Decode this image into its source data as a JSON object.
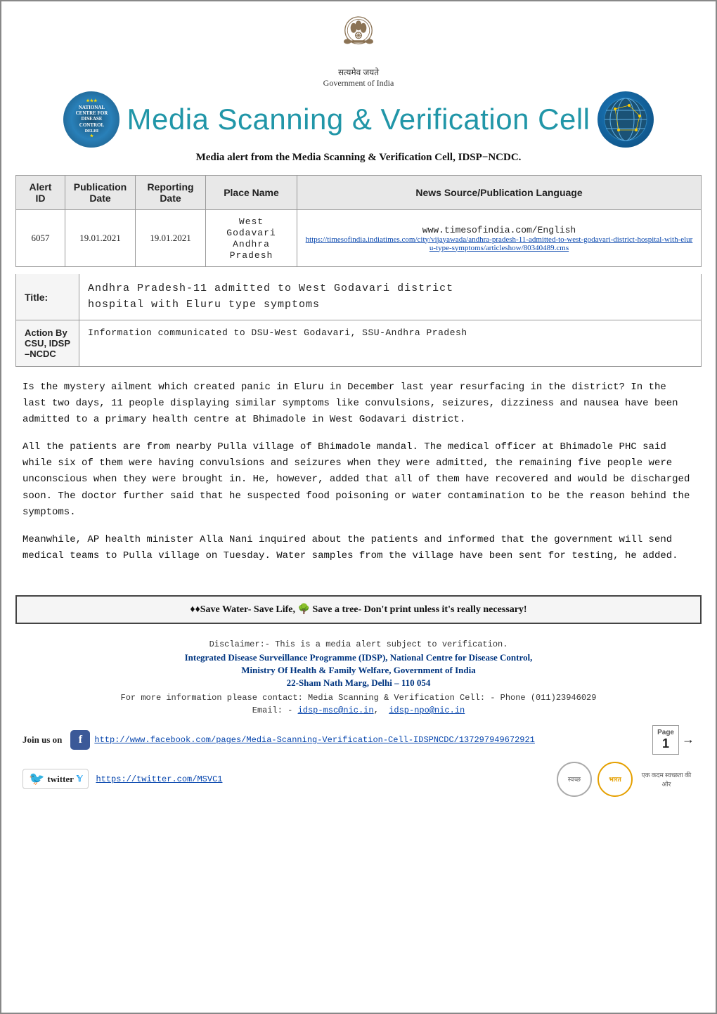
{
  "header": {
    "emblem_alt": "Government of India Emblem",
    "govt_label": "Government of India",
    "satyameva": "सत्यमेव जयते",
    "main_title": "Media Scanning & Verification Cell",
    "subtitle": "Media alert from the Media Scanning & Verification Cell, IDSP−NCDC.",
    "ncdc_label": "NATIONAL CENTRE FOR DISEASE CONTROL DELHI",
    "globe_alt": "Globe icon"
  },
  "table": {
    "headers": [
      "Alert ID",
      "Publication Date",
      "Reporting Date",
      "Place Name",
      "News Source/Publication Language"
    ],
    "row": {
      "alert_id": "6057",
      "pub_date": "19.01.2021",
      "rep_date": "19.01.2021",
      "place": "West Godavari\nAndhra\nPradesh",
      "news_source": "www.timesofindia.com/English",
      "news_link": "https://timesofindia.indiatimes.com/city/vijayawada/andhra-pradesh-11-admitted-to-west-godavari-district-hospital-with-eluru-type-symptoms/articleshow/80340489.cms",
      "news_link_short": "ndhra-pradesh-L-admitted-Lo-WeSt-!odavari-district-"
    }
  },
  "title_section": {
    "label": "Title:",
    "content": "Andhra Pradesh-11 admitted to West Godavari district\nhospital with Eluru type symptoms"
  },
  "action_section": {
    "label": "Action By\nCSU, IDSP\n–NCDC",
    "content": "Information communicated to DSU-West Godavari, SSU-Andhra Pradesh"
  },
  "body": {
    "paragraph1": "Is the mystery ailment which created panic in Eluru in December last year resurfacing in the district? In the last two days, 11 people displaying similar symptoms like convulsions, seizures, dizziness and nausea have been admitted to a primary health centre at Bhimadole in West Godavari district.",
    "paragraph2": "All the patients are from nearby Pulla village of Bhimadole mandal. The medical officer at Bhimadole PHC said while six of them were having convulsions and seizures when they were admitted, the remaining five people were unconscious when they were brought in. He, however, added that all of them have recovered and would be discharged soon. The doctor further said that he suspected food poisoning or water contamination to be the reason behind the symptoms.",
    "paragraph3": "Meanwhile, AP health minister Alla Nani inquired about the patients and informed that the government will send medical teams to Pulla village on Tuesday. Water samples from the village have been sent for testing, he added."
  },
  "footer_banner": {
    "text": "♦Save Water- Save Life, 🌳 Save a tree- Don't print unless it's really necessary!"
  },
  "disclaimer": {
    "line1": "Disclaimer:- This is a media alert subject to verification.",
    "line2": "Integrated Disease Surveillance Programme (IDSP), National Centre for Disease Control,",
    "line3": "Ministry Of Health & Family Welfare, Government of India",
    "line4": "22-Sham Nath Marg, Delhi – 110 054",
    "line5": "For more information please contact: Media Scanning & Verification Cell: - Phone (011)23946029",
    "line6_prefix": "Email: - ",
    "email1": "idsp-msc@nic.in",
    "email1_href": "mailto:idsp-msc@nic.in",
    "email2": "idsp-npo@nic.in",
    "email2_href": "mailto:idsp-npo@nic.in"
  },
  "social": {
    "join_label": "Join us on",
    "fb_icon": "f",
    "fb_link": "http://www.facebook.com/pages/Media-Scanning-Verification-Cell-IDSPNCDC/137297949672921",
    "twitter_badge": "twitter",
    "twitter_link": "https://twitter.com/MSVC1"
  },
  "page": {
    "label": "Page",
    "number": "1",
    "arrow": "→",
    "swachh_label": "स्वच्छ",
    "bharat_label": "भारत",
    "footer_text": "एक कदम स्वच्छता की ओर"
  }
}
